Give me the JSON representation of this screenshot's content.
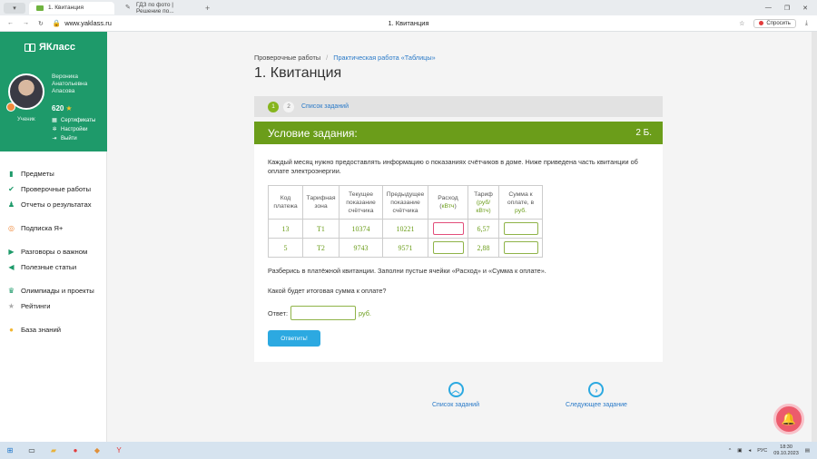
{
  "browser": {
    "tabs": [
      {
        "label": "1. Квитанция",
        "active": true
      },
      {
        "label": "ГДЗ по фото | Решение по...",
        "active": false
      }
    ],
    "new_tab": "+",
    "url": "www.yaklass.ru",
    "page_title": "1. Квитанция",
    "ask_label": "Спросить",
    "win_min": "—",
    "win_max": "❐",
    "win_close": "✕"
  },
  "sidebar": {
    "logo": "ЯКласс",
    "user": {
      "name_line1": "Вероника",
      "name_line2": "Анатольевна",
      "name_line3": "Апасова",
      "points": "620",
      "role": "Ученик"
    },
    "mini_links": [
      {
        "label": "Сертификаты",
        "icon": "certificate-icon"
      },
      {
        "label": "Настройки",
        "icon": "gear-icon"
      },
      {
        "label": "Выйти",
        "icon": "exit-icon"
      }
    ],
    "nav": [
      {
        "label": "Предметы",
        "icon": "bar-chart-icon",
        "color": "#1e9a6a"
      },
      {
        "label": "Проверочные работы",
        "icon": "check-circle-icon",
        "color": "#1e9a6a"
      },
      {
        "label": "Отчеты о результатах",
        "icon": "users-icon",
        "color": "#1e9a6a"
      },
      {
        "label": "Подписка Я+",
        "icon": "subscription-icon",
        "color": "#f08a3c"
      },
      {
        "label": "Разговоры о важном",
        "icon": "video-icon",
        "color": "#1e9a6a"
      },
      {
        "label": "Полезные статьи",
        "icon": "megaphone-icon",
        "color": "#1e9a6a"
      },
      {
        "label": "Олимпиады и проекты",
        "icon": "trophy-icon",
        "color": "#1e9a6a"
      },
      {
        "label": "Рейтинги",
        "icon": "star-icon",
        "color": "#aaaaaa"
      },
      {
        "label": "База знаний",
        "icon": "lightbulb-icon",
        "color": "#f2b631"
      }
    ]
  },
  "breadcrumbs": {
    "item1": "Проверочные работы",
    "item2": "Практическая работа «Таблицы»"
  },
  "page_heading": "1. Квитанция",
  "steps": {
    "step1": "1",
    "step2": "2",
    "list_link": "Список заданий"
  },
  "task": {
    "title": "Условие задания:",
    "score": "2 Б.",
    "description": "Каждый месяц нужно предоставлять информацию о показаниях счётчиков в доме. Ниже приведена часть квитанции об оплате электроэнергии.",
    "table": {
      "headers": {
        "code": "Код платежа",
        "zone": "Тарифная зона",
        "current": "Текущее показание счётчика",
        "previous": "Предыдущее показание счётчика",
        "usage_pre": "Расход (",
        "usage_unit": "кВтч",
        "usage_post": ")",
        "tariff_pre": "Тариф",
        "tariff_unit": "(руб/ кВтч)",
        "sum_pre": "Сумма к оплате, в",
        "sum_unit": "руб."
      },
      "rows": [
        {
          "code": "13",
          "zone": "Т1",
          "current": "10374",
          "previous": "10221",
          "usage": "",
          "tariff": "6,57",
          "sum": ""
        },
        {
          "code": "5",
          "zone": "Т2",
          "current": "9743",
          "previous": "9571",
          "usage": "",
          "tariff": "2,88",
          "sum": ""
        }
      ]
    },
    "instruction": "Разберись в платёжной квитанции. Заполни пустые ячейки «Расход» и «Сумма к оплате».",
    "question": "Какой будет итоговая сумма к оплате?",
    "answer_label": "Ответ:",
    "answer_value": "",
    "answer_unit": "руб.",
    "submit_label": "Ответить!"
  },
  "bottom_nav": {
    "list": "Список заданий",
    "next": "Следующее задание"
  },
  "taskbar": {
    "lang": "РУС",
    "time": "18:30",
    "date": "09.10.2023"
  },
  "colors": {
    "green": "#1e9a6a",
    "task_green": "#6b9d1a",
    "blue": "#2ca9e1",
    "link": "#2a7ac8",
    "alert": "#ec5b6c"
  }
}
